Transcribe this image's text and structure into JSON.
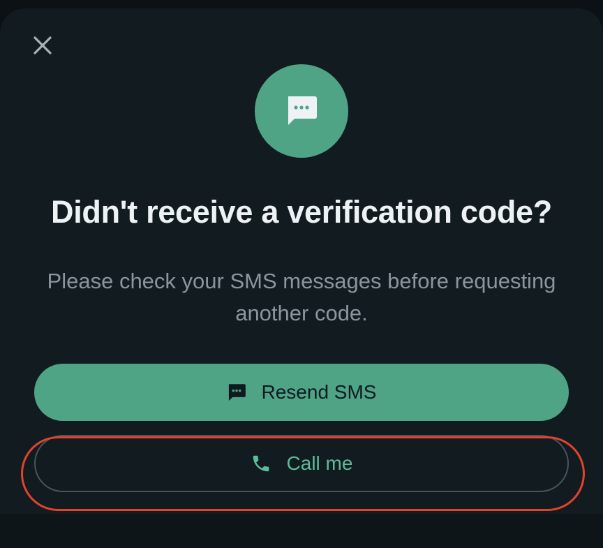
{
  "dialog": {
    "title": "Didn't receive a verification code?",
    "message": "Please check your SMS messages before requesting another code.",
    "close_icon": "close-icon",
    "hero_icon": "message-bubble-icon"
  },
  "actions": {
    "resend_label": "Resend SMS",
    "resend_icon": "message-bubble-icon",
    "call_label": "Call me",
    "call_icon": "phone-icon"
  },
  "colors": {
    "accent": "#4fa486",
    "accent_text": "#5dbd97",
    "background": "#121b20",
    "highlight": "#e2432b"
  }
}
